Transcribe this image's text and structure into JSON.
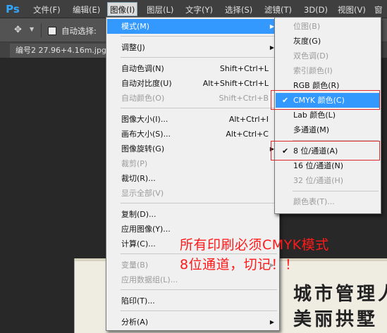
{
  "app": {
    "logo": "Ps"
  },
  "menubar": {
    "items": [
      "文件(F)",
      "编辑(E)",
      "图像(I)",
      "图层(L)",
      "文字(Y)",
      "选择(S)",
      "滤镜(T)",
      "3D(D)",
      "视图(V)",
      "窗"
    ]
  },
  "options": {
    "auto_select_label": "自动选择:",
    "move_icon": "move-tool-icon"
  },
  "document": {
    "tab_title": "编号2 27.96+4.16m.jpg"
  },
  "image_menu": {
    "items": [
      {
        "label": "模式(M)",
        "shortcut": "",
        "submenu": true,
        "disabled": false,
        "highlighted": true
      },
      {
        "label": "调整(J)",
        "shortcut": "",
        "submenu": true,
        "disabled": false
      },
      {
        "label": "自动色调(N)",
        "shortcut": "Shift+Ctrl+L",
        "disabled": false
      },
      {
        "label": "自动对比度(U)",
        "shortcut": "Alt+Shift+Ctrl+L",
        "disabled": false
      },
      {
        "label": "自动颜色(O)",
        "shortcut": "Shift+Ctrl+B",
        "disabled": true
      },
      {
        "label": "图像大小(I)...",
        "shortcut": "Alt+Ctrl+I",
        "disabled": false
      },
      {
        "label": "画布大小(S)...",
        "shortcut": "Alt+Ctrl+C",
        "disabled": false
      },
      {
        "label": "图像旋转(G)",
        "shortcut": "",
        "submenu": true,
        "disabled": false
      },
      {
        "label": "裁剪(P)",
        "shortcut": "",
        "disabled": true
      },
      {
        "label": "裁切(R)...",
        "shortcut": "",
        "disabled": false
      },
      {
        "label": "显示全部(V)",
        "shortcut": "",
        "disabled": true
      },
      {
        "label": "复制(D)...",
        "shortcut": "",
        "disabled": false
      },
      {
        "label": "应用图像(Y)...",
        "shortcut": "",
        "disabled": false
      },
      {
        "label": "计算(C)...",
        "shortcut": "",
        "disabled": false
      },
      {
        "label": "变量(B)",
        "shortcut": "",
        "submenu": true,
        "disabled": true
      },
      {
        "label": "应用数据组(L)...",
        "shortcut": "",
        "disabled": true
      },
      {
        "label": "陷印(T)...",
        "shortcut": "",
        "disabled": false
      },
      {
        "label": "分析(A)",
        "shortcut": "",
        "submenu": true,
        "disabled": false
      }
    ]
  },
  "mode_submenu": {
    "items": [
      {
        "label": "位图(B)",
        "disabled": true,
        "checked": false
      },
      {
        "label": "灰度(G)",
        "disabled": false,
        "checked": false
      },
      {
        "label": "双色调(D)",
        "disabled": true,
        "checked": false
      },
      {
        "label": "索引颜色(I)",
        "disabled": true,
        "checked": false
      },
      {
        "label": "RGB 颜色(R)",
        "disabled": false,
        "checked": false
      },
      {
        "label": "CMYK 颜色(C)",
        "disabled": false,
        "checked": true,
        "highlighted": true
      },
      {
        "label": "Lab 颜色(L)",
        "disabled": false,
        "checked": false
      },
      {
        "label": "多通道(M)",
        "disabled": false,
        "checked": false
      },
      {
        "label": "8 位/通道(A)",
        "disabled": false,
        "checked": true
      },
      {
        "label": "16 位/通道(N)",
        "disabled": false,
        "checked": false
      },
      {
        "label": "32 位/通道(H)",
        "disabled": true,
        "checked": false
      },
      {
        "label": "颜色表(T)...",
        "disabled": true,
        "checked": false
      }
    ],
    "check_glyph": "✔"
  },
  "annotation": {
    "line1": "所有印刷必须CMYK模式",
    "line2": "8位通道，切记！！",
    "color": "#ff1a1a"
  },
  "canvas": {
    "line1": "城市管理人",
    "line2": "美丽拱墅"
  },
  "colors": {
    "highlight": "#3399ff",
    "menu_bg": "#f0f0f0",
    "menubar_bg": "#3f3f3f",
    "redbox": "#e0282a"
  }
}
